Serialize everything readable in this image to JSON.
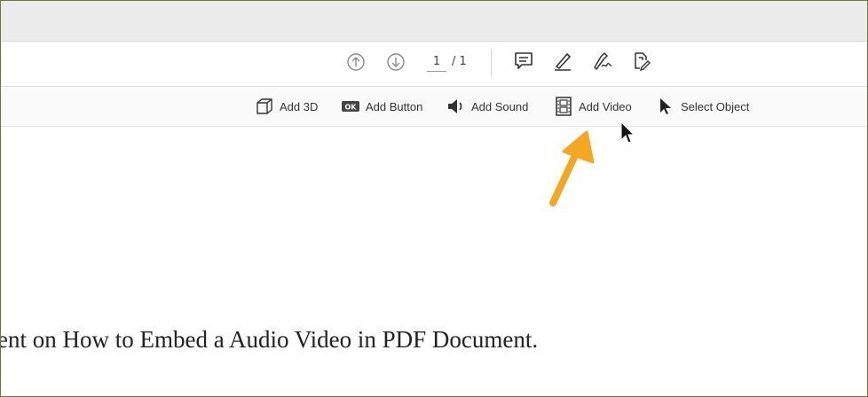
{
  "page_nav": {
    "current_page": "1",
    "total_pages": "/ 1"
  },
  "icons": {
    "nav_up": "circle-arrow-up-icon",
    "nav_down": "circle-arrow-down-icon",
    "comment": "comment-icon",
    "highlight": "highlighter-pen-icon",
    "sign": "sign-pen-icon",
    "edit_pdf": "edit-pdf-icon"
  },
  "rich_media_toolbar": {
    "items": [
      {
        "label": "Add 3D",
        "icon": "cube-3d-icon"
      },
      {
        "label": "Add Button",
        "icon": "ok-button-icon"
      },
      {
        "label": "Add Sound",
        "icon": "speaker-icon"
      },
      {
        "label": "Add Video",
        "icon": "film-icon"
      },
      {
        "label": "Select Object",
        "icon": "cursor-arrow-icon"
      }
    ]
  },
  "document": {
    "visible_text": "ent on How to Embed a Audio Video in PDF Document."
  },
  "colors": {
    "annotation_arrow": "#f5a623",
    "frame_border": "#6b7a33"
  }
}
